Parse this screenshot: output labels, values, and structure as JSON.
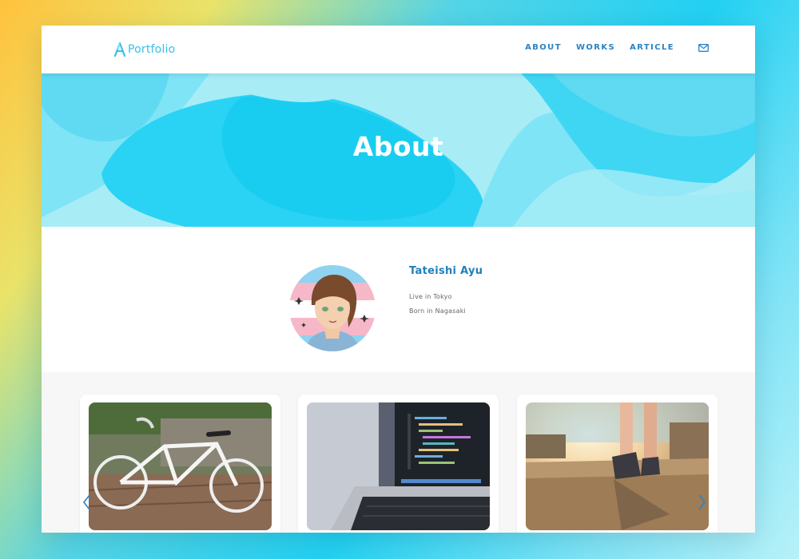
{
  "header": {
    "logo_text": "Portfolio",
    "nav": [
      {
        "label": "ABOUT"
      },
      {
        "label": "WORKS"
      },
      {
        "label": "ARTICLE"
      }
    ],
    "mail_icon": "mail-icon"
  },
  "hero": {
    "title": "About"
  },
  "profile": {
    "name": "Tateishi Ayu",
    "lines": [
      "Live in Tokyo",
      "Born in Nagasaki"
    ],
    "avatar": "avatar-illustration"
  },
  "gallery": {
    "items": [
      {
        "photo": "road-bicycle-photo"
      },
      {
        "photo": "laptop-code-photo"
      },
      {
        "photo": "walking-feet-photo"
      }
    ],
    "prev_icon": "chevron-left-icon",
    "next_icon": "chevron-right-icon"
  },
  "colors": {
    "accent": "#2a83c4",
    "logo": "#39c1e4",
    "hero_light": "#a8ecf6",
    "hero_mid": "#5fdaf2",
    "hero_deep": "#19cdf1"
  }
}
